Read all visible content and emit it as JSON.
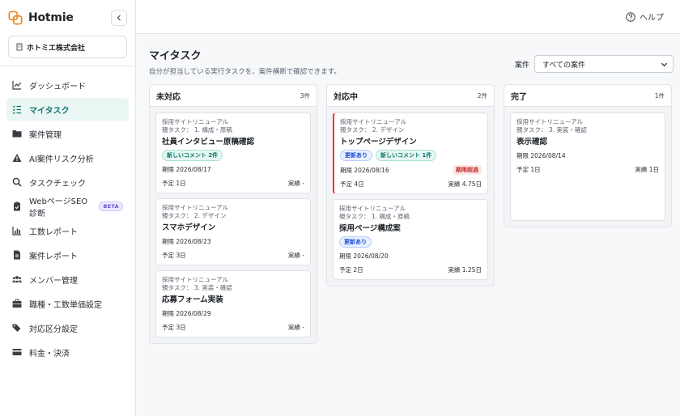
{
  "brand": {
    "name": "Hotmie"
  },
  "company": {
    "name": "ホトミエ株式会社"
  },
  "nav": [
    {
      "label": "ダッシュボード",
      "icon": "chart-line-icon",
      "active": false
    },
    {
      "label": "マイタスク",
      "icon": "task-list-icon",
      "active": true
    },
    {
      "label": "案件管理",
      "icon": "folder-icon",
      "active": false
    },
    {
      "label": "AI案件リスク分析",
      "icon": "warning-icon",
      "active": false
    },
    {
      "label": "タスクチェック",
      "icon": "search-icon",
      "active": false
    },
    {
      "label": "WebページSEO診断",
      "icon": "clipboard-check-icon",
      "active": false,
      "badge": "BETA"
    },
    {
      "label": "工数レポート",
      "icon": "bar-chart-icon",
      "active": false
    },
    {
      "label": "案件レポート",
      "icon": "document-icon",
      "active": false
    },
    {
      "label": "メンバー管理",
      "icon": "users-icon",
      "active": false
    },
    {
      "label": "職種・工数単価設定",
      "icon": "briefcase-icon",
      "active": false
    },
    {
      "label": "対応区分設定",
      "icon": "tags-icon",
      "active": false
    },
    {
      "label": "料金・決済",
      "icon": "credit-card-icon",
      "active": false
    }
  ],
  "topbar": {
    "help_label": "ヘルプ"
  },
  "page": {
    "title": "マイタスク",
    "subtitle": "自分が担当している実行タスクを、案件横断で確認できます。",
    "filter_label": "案件",
    "filter_value": "すべての案件"
  },
  "columns": [
    {
      "title": "未対応",
      "count": "3件",
      "cards": [
        {
          "project": "採用サイトリニューアル",
          "parent": "親タスク： 1. 構成・原稿",
          "title": "社員インタビュー原稿確認",
          "tags": [
            {
              "type": "cmt",
              "label": "新しいコメント 2件"
            }
          ],
          "due": "期限 2026/08/17",
          "overdue": "",
          "plan": "予定 1日",
          "actual": "実績 -"
        },
        {
          "project": "採用サイトリニューアル",
          "parent": "親タスク： 2. デザイン",
          "title": "スマホデザイン",
          "tags": [],
          "due": "期限 2026/08/23",
          "overdue": "",
          "plan": "予定 3日",
          "actual": "実績 -"
        },
        {
          "project": "採用サイトリニューアル",
          "parent": "親タスク： 3. 実装・確認",
          "title": "応募フォーム実装",
          "tags": [],
          "due": "期限 2026/08/29",
          "overdue": "",
          "plan": "予定 3日",
          "actual": "実績 -"
        }
      ]
    },
    {
      "title": "対応中",
      "count": "2件",
      "cards": [
        {
          "project": "採用サイトリニューアル",
          "parent": "親タスク： 2. デザイン",
          "title": "トップページデザイン",
          "tags": [
            {
              "type": "upd",
              "label": "更新あり"
            },
            {
              "type": "cmt",
              "label": "新しいコメント 1件"
            }
          ],
          "due": "期限 2026/08/16",
          "overdue": "期限超過",
          "plan": "予定 4日",
          "actual": "実績 4.75日"
        },
        {
          "project": "採用サイトリニューアル",
          "parent": "親タスク： 1. 構成・原稿",
          "title": "採用ページ構成案",
          "tags": [
            {
              "type": "upd",
              "label": "更新あり"
            }
          ],
          "due": "期限 2026/08/20",
          "overdue": "",
          "plan": "予定 2日",
          "actual": "実績 1.25日"
        }
      ]
    },
    {
      "title": "完了",
      "count": "1件",
      "cards": [
        {
          "project": "採用サイトリニューアル",
          "parent": "親タスク： 3. 実装・確認",
          "title": "表示確認",
          "tags": [],
          "due": "期限 2026/08/14",
          "overdue": "",
          "plan": "予定 1日",
          "actual": "実績 1日"
        }
      ]
    }
  ],
  "colors": {
    "accent": "#0f766e",
    "active_bg": "#e9f6f4",
    "overdue": "#e23b3b",
    "brand_orange": "#f08a24"
  }
}
